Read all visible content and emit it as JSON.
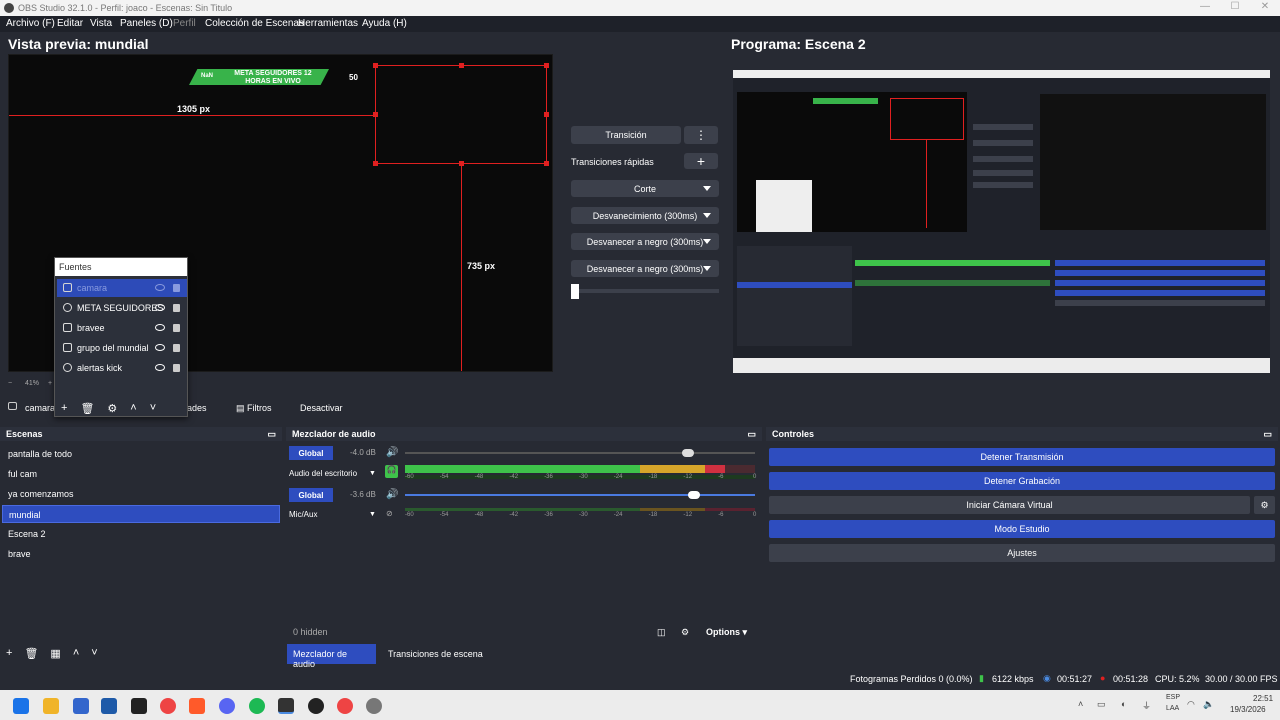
{
  "window": {
    "title": "OBS Studio 32.1.0 - Perfil: joaco - Escenas: Sin Titulo"
  },
  "menu": [
    "Archivo (F)",
    "Editar",
    "Vista",
    "Paneles (D)",
    "Perfil",
    "Colección de Escenas",
    "Herramientas",
    "Ayuda (H)"
  ],
  "preview": {
    "title": "Vista previa: mundial",
    "banner_text": "META SEGUIDORES 12 HORAS EN VIVO",
    "banner_count": "50",
    "width_label": "1305 px",
    "height_label": "735 px",
    "zoom": "41%"
  },
  "program": {
    "title": "Programa: Escena 2"
  },
  "transitions": {
    "transition_button": "Transición",
    "quick_label": "Transiciones rápidas",
    "items": [
      "Corte",
      "Desvanecimiento (300ms)",
      "Desvanecer a negro (300ms)",
      "Desvanecer a negro (300ms)"
    ]
  },
  "fuentes": {
    "title": "Fuentes",
    "items": [
      "camara",
      "META SEGUIDORES",
      "bravee",
      "grupo del mundial",
      "alertas kick"
    ]
  },
  "source_toolbar": {
    "current": "camara",
    "propiedades": "Propiedades",
    "filtros": "Filtros",
    "desactivar": "Desactivar"
  },
  "escenas": {
    "title": "Escenas",
    "items": [
      "pantalla de todo",
      "ful cam",
      "ya comenzamos",
      "mundial",
      "Escena 2",
      "brave"
    ],
    "selected_index": 3
  },
  "mixer": {
    "title": "Mezclador de audio",
    "channels": [
      {
        "global": "Global",
        "db": "-4.0 dB",
        "name": "Audio del escritorio",
        "volume": 0.82
      },
      {
        "global": "Global",
        "db": "-3.6 dB",
        "name": "Mic/Aux",
        "volume": 0.83
      }
    ],
    "scale": [
      "-60",
      "-54",
      "-48",
      "-42",
      "-36",
      "-30",
      "-24",
      "-18",
      "-12",
      "-6",
      "0"
    ],
    "hidden": "0 hidden",
    "options": "Options",
    "tab_audio": "Mezclador de audio",
    "tab_transitions": "Transiciones de escena"
  },
  "controles": {
    "title": "Controles",
    "buttons": [
      "Detener Transmisión",
      "Detener Grabación",
      "Iniciar Cámara Virtual",
      "Modo Estudio",
      "Ajustes"
    ]
  },
  "status": {
    "frames": "Fotogramas Perdidos 0 (0.0%)",
    "kbps": "6122 kbps",
    "stream_time": "00:51:27",
    "rec_time": "00:51:28",
    "cpu": "CPU: 5.2%",
    "fps": "30.00 / 30.00 FPS"
  },
  "taskbar": {
    "lang1": "ESP",
    "lang2": "LAA",
    "time": "22:51",
    "date": "19/3/2026"
  },
  "colors": {
    "accent": "#2e4dbf",
    "panel": "#272a33",
    "red_box": "#e02020",
    "meter_green": "#3ec34a"
  }
}
